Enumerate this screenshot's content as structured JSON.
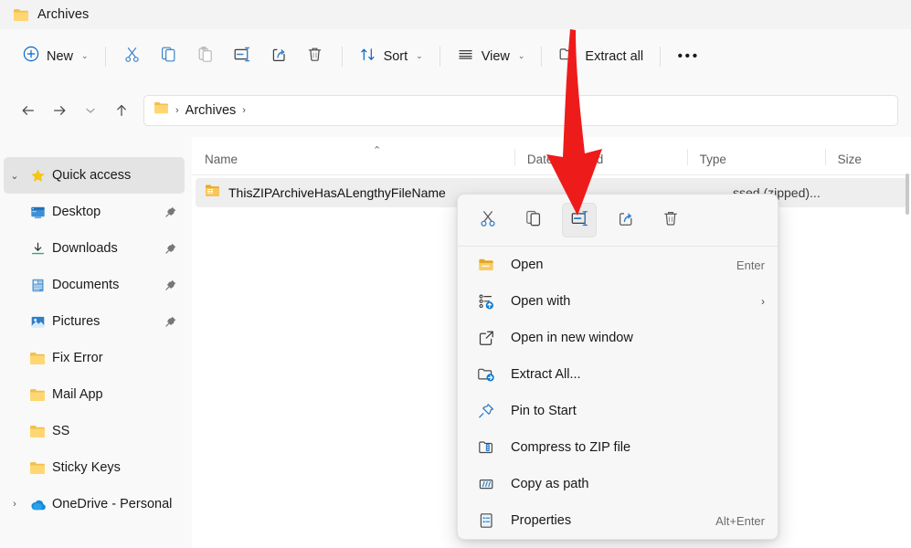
{
  "window": {
    "title": "Archives",
    "title_icon": "folder-icon"
  },
  "colors": {
    "accent": "#0a66c2",
    "folder": "#f7c460",
    "annotation": "#ee1b1b",
    "selection": "#eeeeee"
  },
  "toolbar": {
    "new_label": "New",
    "new_chevron": "⌄",
    "cut_icon": "scissors-icon",
    "copy_icon": "copy-icon",
    "paste_icon": "paste-icon",
    "rename_icon": "rename-icon",
    "share_icon": "share-icon",
    "delete_icon": "trash-icon",
    "sort_label": "Sort",
    "sort_chevron": "⌄",
    "view_label": "View",
    "view_chevron": "⌄",
    "extract_all_label": "Extract all",
    "more_label": "•••"
  },
  "address": {
    "back_icon": "arrow-left-icon",
    "forward_icon": "arrow-right-icon",
    "recent_icon": "chevron-down-icon",
    "up_icon": "arrow-up-icon",
    "folder_icon": "folder-icon",
    "crumbs": [
      "Archives"
    ],
    "separator": "›",
    "trailing_separator": "›"
  },
  "sidebar": {
    "items": [
      {
        "label": "Quick access",
        "icon": "star-icon",
        "twisty": "⌄",
        "level": 0,
        "selected": true,
        "pinned": false
      },
      {
        "label": "Desktop",
        "icon": "desktop-icon",
        "twisty": "",
        "level": 1,
        "selected": false,
        "pinned": true
      },
      {
        "label": "Downloads",
        "icon": "download-icon",
        "twisty": "",
        "level": 1,
        "selected": false,
        "pinned": true
      },
      {
        "label": "Documents",
        "icon": "document-icon",
        "twisty": "",
        "level": 1,
        "selected": false,
        "pinned": true
      },
      {
        "label": "Pictures",
        "icon": "picture-icon",
        "twisty": "",
        "level": 1,
        "selected": false,
        "pinned": true
      },
      {
        "label": "Fix Error",
        "icon": "folder-icon",
        "twisty": "",
        "level": 1,
        "selected": false,
        "pinned": false
      },
      {
        "label": "Mail App",
        "icon": "folder-icon",
        "twisty": "",
        "level": 1,
        "selected": false,
        "pinned": false
      },
      {
        "label": "SS",
        "icon": "folder-icon",
        "twisty": "",
        "level": 1,
        "selected": false,
        "pinned": false
      },
      {
        "label": "Sticky Keys",
        "icon": "folder-icon",
        "twisty": "",
        "level": 1,
        "selected": false,
        "pinned": false
      },
      {
        "label": "OneDrive - Personal",
        "icon": "onedrive-cloud-icon",
        "twisty": "›",
        "level": 0,
        "selected": false,
        "pinned": false
      }
    ]
  },
  "filelist": {
    "columns": [
      {
        "label": "Name",
        "sorted": true,
        "sort_caret": "⌃"
      },
      {
        "label": "Date modified",
        "sorted": false,
        "sort_caret": ""
      },
      {
        "label": "Type",
        "sorted": false,
        "sort_caret": ""
      },
      {
        "label": "Size",
        "sorted": false,
        "sort_caret": ""
      }
    ],
    "rows": [
      {
        "name": "ThisZIPArchiveHasALengthyFileName",
        "icon": "zip-archive-icon",
        "date_modified": "",
        "type": "ssed (zipped)...",
        "size": "",
        "selected": true
      }
    ]
  },
  "context_menu": {
    "icon_row": [
      {
        "name": "cut-icon",
        "label": "Cut",
        "highlighted": false
      },
      {
        "name": "copy-icon",
        "label": "Copy",
        "highlighted": false
      },
      {
        "name": "rename-icon",
        "label": "Rename",
        "highlighted": true
      },
      {
        "name": "share-icon",
        "label": "Share",
        "highlighted": false
      },
      {
        "name": "delete-icon",
        "label": "Delete",
        "highlighted": false
      }
    ],
    "items": [
      {
        "label": "Open",
        "icon": "open-folder-icon",
        "accel": "Enter",
        "submenu": false
      },
      {
        "label": "Open with",
        "icon": "open-with-icon",
        "accel": "",
        "submenu": true,
        "submenu_glyph": "›"
      },
      {
        "label": "Open in new window",
        "icon": "new-window-icon",
        "accel": "",
        "submenu": false
      },
      {
        "label": "Extract All...",
        "icon": "extract-all-icon",
        "accel": "",
        "submenu": false
      },
      {
        "label": "Pin to Start",
        "icon": "pin-icon",
        "accel": "",
        "submenu": false
      },
      {
        "label": "Compress to ZIP file",
        "icon": "compress-zip-icon",
        "accel": "",
        "submenu": false
      },
      {
        "label": "Copy as path",
        "icon": "copy-path-icon",
        "accel": "",
        "submenu": false
      },
      {
        "label": "Properties",
        "icon": "properties-icon",
        "accel": "Alt+Enter",
        "submenu": false
      }
    ]
  },
  "annotation": {
    "type": "red-down-arrow",
    "points_to": "rename-icon",
    "color": "#ee1b1b"
  }
}
